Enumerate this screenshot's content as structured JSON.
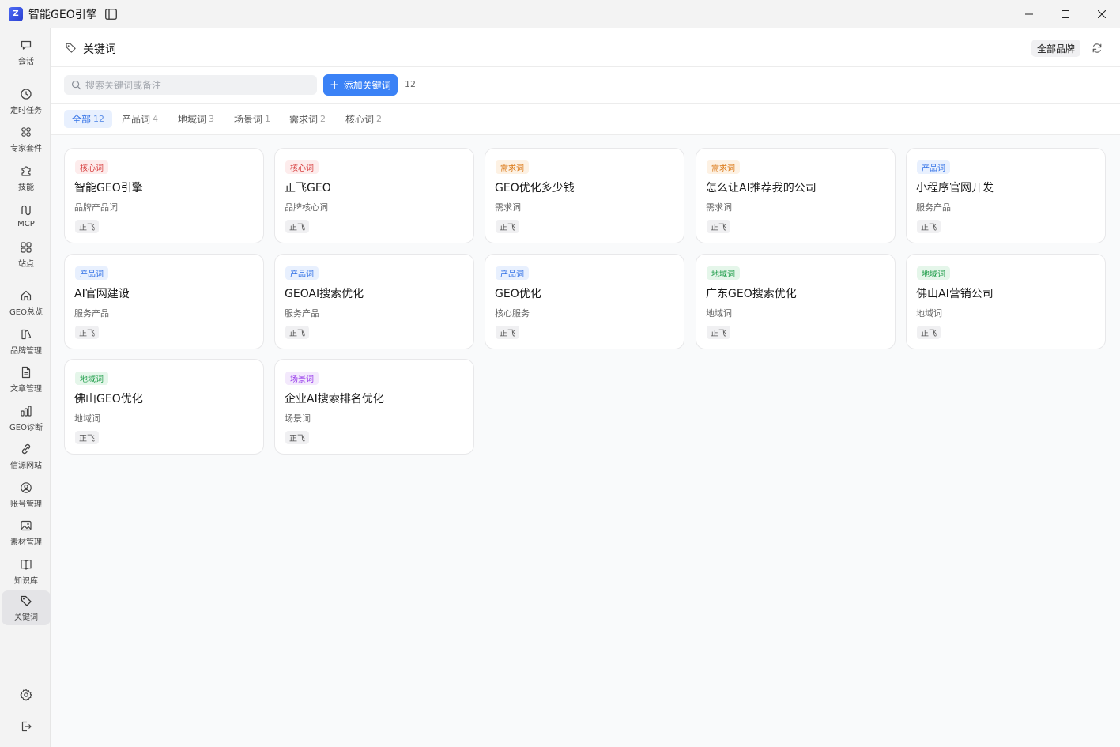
{
  "window": {
    "title": "智能GEO引擎",
    "logo_text": "Z"
  },
  "sidebar": {
    "items": [
      {
        "label": "会话",
        "icon": "chat-icon"
      },
      {
        "label": "定时任务",
        "icon": "clock-icon"
      },
      {
        "label": "专家套件",
        "icon": "grid-dots-icon"
      },
      {
        "label": "技能",
        "icon": "puzzle-icon"
      },
      {
        "label": "MCP",
        "icon": "mcp-icon"
      },
      {
        "label": "站点",
        "icon": "sites-icon"
      },
      {
        "label": "GEO总览",
        "icon": "home-icon"
      },
      {
        "label": "品牌管理",
        "icon": "brand-icon"
      },
      {
        "label": "文章管理",
        "icon": "document-icon"
      },
      {
        "label": "GEO诊断",
        "icon": "bar-chart-icon"
      },
      {
        "label": "信源网站",
        "icon": "link-icon"
      },
      {
        "label": "账号管理",
        "icon": "user-circle-icon"
      },
      {
        "label": "素材管理",
        "icon": "image-icon"
      },
      {
        "label": "知识库",
        "icon": "book-icon"
      },
      {
        "label": "关键词",
        "icon": "tag-icon"
      }
    ],
    "active": "关键词"
  },
  "header": {
    "title": "关键词",
    "brand_filter": "全部品牌"
  },
  "search": {
    "placeholder": "搜索关键词或备注",
    "value": ""
  },
  "add_button": {
    "label": "添加关键词"
  },
  "total_count": "12",
  "filters": [
    {
      "label": "全部",
      "count": "12",
      "active": true
    },
    {
      "label": "产品词",
      "count": "4"
    },
    {
      "label": "地域词",
      "count": "3"
    },
    {
      "label": "场景词",
      "count": "1"
    },
    {
      "label": "需求词",
      "count": "2"
    },
    {
      "label": "核心词",
      "count": "2"
    }
  ],
  "cards": [
    {
      "type": "核心词",
      "keyword": "智能GEO引擎",
      "note": "品牌产品词",
      "brand": "正飞"
    },
    {
      "type": "核心词",
      "keyword": "正飞GEO",
      "note": "品牌核心词",
      "brand": "正飞"
    },
    {
      "type": "需求词",
      "keyword": "GEO优化多少钱",
      "note": "需求词",
      "brand": "正飞"
    },
    {
      "type": "需求词",
      "keyword": "怎么让AI推荐我的公司",
      "note": "需求词",
      "brand": "正飞"
    },
    {
      "type": "产品词",
      "keyword": "小程序官网开发",
      "note": "服务产品",
      "brand": "正飞"
    },
    {
      "type": "产品词",
      "keyword": "AI官网建设",
      "note": "服务产品",
      "brand": "正飞"
    },
    {
      "type": "产品词",
      "keyword": "GEOAI搜索优化",
      "note": "服务产品",
      "brand": "正飞"
    },
    {
      "type": "产品词",
      "keyword": "GEO优化",
      "note": "核心服务",
      "brand": "正飞"
    },
    {
      "type": "地域词",
      "keyword": "广东GEO搜索优化",
      "note": "地域词",
      "brand": "正飞"
    },
    {
      "type": "地域词",
      "keyword": "佛山AI营销公司",
      "note": "地域词",
      "brand": "正飞"
    },
    {
      "type": "地域词",
      "keyword": "佛山GEO优化",
      "note": "地域词",
      "brand": "正飞"
    },
    {
      "type": "场景词",
      "keyword": "企业AI搜索排名优化",
      "note": "场景词",
      "brand": "正飞"
    }
  ],
  "badge_colors": {
    "核心词": "#d63b3b",
    "需求词": "#d9730d",
    "产品词": "#2f6fe6",
    "地域词": "#1f9d4a",
    "场景词": "#9333ea"
  },
  "accent_color": "#3b82f6"
}
